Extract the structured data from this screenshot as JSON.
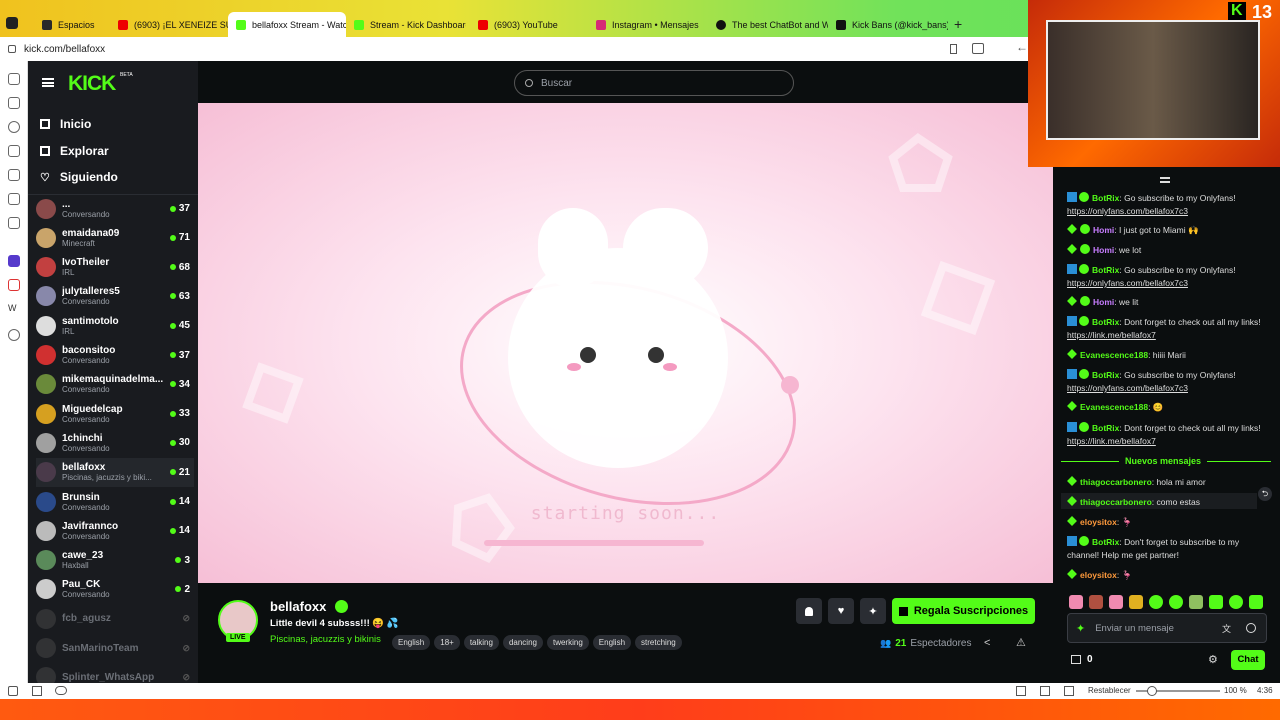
{
  "browser": {
    "tabs": [
      {
        "label": "Espacios"
      },
      {
        "label": "(6903) ¡EL XENEIZE SUFRIC"
      },
      {
        "label": "bellafoxx Stream - Watch L"
      },
      {
        "label": "Stream - Kick Dashboard"
      },
      {
        "label": "(6903) YouTube"
      },
      {
        "label": "Instagram • Mensajes"
      },
      {
        "label": "The best ChatBot and Widg"
      },
      {
        "label": "Kick Bans (@kick_bans) / X"
      }
    ],
    "url": "kick.com/bellafoxx"
  },
  "site": {
    "logo": "KICK",
    "logo_badge": "BETA",
    "search_placeholder": "Buscar"
  },
  "nav": [
    {
      "label": "Inicio",
      "icon": "home-icon"
    },
    {
      "label": "Explorar",
      "icon": "compass-icon"
    },
    {
      "label": "Siguiendo",
      "icon": "heart-icon"
    }
  ],
  "channels": [
    {
      "name": "...",
      "category": "Conversando",
      "viewers": "37",
      "live": true
    },
    {
      "name": "emaidana09",
      "category": "Minecraft",
      "viewers": "71",
      "live": true
    },
    {
      "name": "IvoTheiler",
      "category": "IRL",
      "viewers": "68",
      "live": true
    },
    {
      "name": "julytalleres5",
      "category": "Conversando",
      "viewers": "63",
      "live": true
    },
    {
      "name": "santimotolo",
      "category": "IRL",
      "viewers": "45",
      "live": true
    },
    {
      "name": "baconsitoo",
      "category": "Conversando",
      "viewers": "37",
      "live": true
    },
    {
      "name": "mikemaquinadelma...",
      "category": "Conversando",
      "viewers": "34",
      "live": true
    },
    {
      "name": "Miguedelcap",
      "category": "Conversando",
      "viewers": "33",
      "live": true
    },
    {
      "name": "1chinchi",
      "category": "Conversando",
      "viewers": "30",
      "live": true
    },
    {
      "name": "bellafoxx",
      "category": "Piscinas, jacuzzis y biki...",
      "viewers": "21",
      "live": true
    },
    {
      "name": "Brunsin",
      "category": "Conversando",
      "viewers": "14",
      "live": true
    },
    {
      "name": "Javifrannco",
      "category": "Conversando",
      "viewers": "14",
      "live": true
    },
    {
      "name": "cawe_23",
      "category": "Haxball",
      "viewers": "3",
      "live": true
    },
    {
      "name": "Pau_CK",
      "category": "Conversando",
      "viewers": "2",
      "live": true
    },
    {
      "name": "fcb_agusz",
      "category": "",
      "viewers": "",
      "live": false
    },
    {
      "name": "SanMarinoTeam",
      "category": "",
      "viewers": "",
      "live": false
    },
    {
      "name": "Splinter_WhatsApp",
      "category": "",
      "viewers": "",
      "live": false
    }
  ],
  "player": {
    "overlay_text": "starting soon..."
  },
  "stream": {
    "streamer": "bellafoxx",
    "live_badge": "LIVE",
    "title": "Little devil 4 subsss!!! 😝 💦",
    "category": "Piscinas, jacuzzis y bikinis",
    "tags": [
      "English",
      "18+",
      "talking",
      "dancing",
      "twerking",
      "English",
      "stretching"
    ],
    "subscribe_label": "Regala Suscripciones",
    "viewers": "21",
    "viewers_label": "Espectadores"
  },
  "chat": {
    "messages": [
      {
        "user": "BotRix",
        "color": "#53fc18",
        "bot": true,
        "text": "Go subscribe to my Onlyfans! ",
        "link": "https://onlyfans.com/bellafox7c3"
      },
      {
        "user": "Homi",
        "color": "#c77dff",
        "bot": false,
        "text": "I just got to Miami 🙌",
        "link": ""
      },
      {
        "user": "Homi",
        "color": "#c77dff",
        "bot": false,
        "text": "we lot",
        "link": ""
      },
      {
        "user": "BotRix",
        "color": "#53fc18",
        "bot": true,
        "text": "Go subscribe to my Onlyfans! ",
        "link": "https://onlyfans.com/bellafox7c3"
      },
      {
        "user": "Homi",
        "color": "#c77dff",
        "bot": false,
        "text": "we lit",
        "link": ""
      },
      {
        "user": "BotRix",
        "color": "#53fc18",
        "bot": true,
        "text": "Dont forget to check out all my links! ",
        "link": "https://link.me/bellafox7"
      },
      {
        "user": "Evanescence188",
        "color": "#53fc18",
        "bot": false,
        "text": "hiiii Marii",
        "link": ""
      },
      {
        "user": "BotRix",
        "color": "#53fc18",
        "bot": true,
        "text": "Go subscribe to my Onlyfans! ",
        "link": "https://onlyfans.com/bellafox7c3"
      },
      {
        "user": "Evanescence188",
        "color": "#53fc18",
        "bot": false,
        "text": "😊",
        "link": ""
      },
      {
        "user": "BotRix",
        "color": "#53fc18",
        "bot": true,
        "text": "Dont forget to check out all my links! ",
        "link": "https://link.me/bellafox7"
      }
    ],
    "new_messages_label": "Nuevos mensajes",
    "new": [
      {
        "user": "thiagoccarbonero",
        "color": "#53fc18",
        "bot": false,
        "text": "hola mi amor",
        "link": ""
      },
      {
        "user": "thiagoccarbonero",
        "color": "#53fc18",
        "bot": false,
        "text": "como estas",
        "link": ""
      },
      {
        "user": "eloysitox",
        "color": "#ff9a3c",
        "bot": false,
        "text": "🦩",
        "link": ""
      },
      {
        "user": "BotRix",
        "color": "#53fc18",
        "bot": true,
        "text": "Don't forget to subscribe to my channel! Help me get partner!",
        "link": ""
      },
      {
        "user": "eloysitox",
        "color": "#ff9a3c",
        "bot": false,
        "text": "🦩",
        "link": ""
      }
    ],
    "input_placeholder": "Enviar un mensaje",
    "points": "0",
    "chat_button": "Chat"
  },
  "statusbar": {
    "reset_label": "Restablecer",
    "zoom": "100 %",
    "time": "4:36"
  },
  "overlay": {
    "cam_number": "13"
  }
}
